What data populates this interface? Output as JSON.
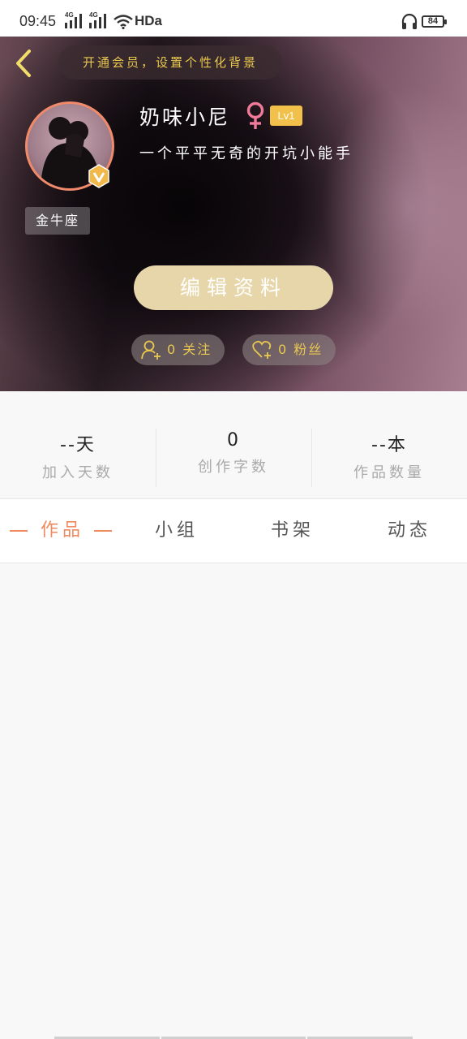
{
  "status_bar": {
    "time": "09:45",
    "network_1": "4G",
    "network_2": "4G",
    "hd_label": "HDa",
    "battery": "84"
  },
  "header": {
    "vip_banner": "开通会员，设置个性化背景",
    "username": "奶味小尼",
    "gender_symbol": "♀",
    "level": "Lv1",
    "bio": "一个平平无奇的开坑小能手",
    "zodiac": "金牛座",
    "edit_button": "编辑资料",
    "follow_label": "0 关注",
    "fans_label": "0 粉丝"
  },
  "stats": [
    {
      "value": "--天",
      "label": "加入天数"
    },
    {
      "value": "0",
      "label": "创作字数"
    },
    {
      "value": "--本",
      "label": "作品数量"
    }
  ],
  "tabs": {
    "works": "作品",
    "group": "小组",
    "bookshelf": "书架",
    "activity": "动态"
  },
  "colors": {
    "accent": "#ee8a5f",
    "gold": "#e9c84f",
    "edit_button_bg": "#e7d6a9",
    "level_bg": "#f2c14b",
    "gender_pink": "#f07a9a"
  }
}
